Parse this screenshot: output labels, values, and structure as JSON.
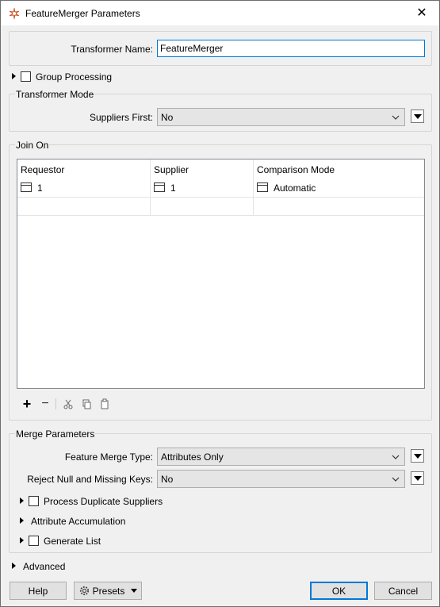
{
  "window": {
    "title": "FeatureMerger Parameters",
    "close_glyph": "✕"
  },
  "transformer_name": {
    "label": "Transformer Name:",
    "value": "FeatureMerger"
  },
  "group_processing": {
    "label": "Group Processing",
    "checked": false
  },
  "transformer_mode": {
    "group_label": "Transformer Mode",
    "suppliers_first_label": "Suppliers First:",
    "suppliers_first_value": "No"
  },
  "join_on": {
    "group_label": "Join On",
    "columns": [
      "Requestor",
      "Supplier",
      "Comparison Mode"
    ],
    "rows": [
      {
        "requestor": "1",
        "supplier": "1",
        "comparison_mode": "Automatic"
      }
    ],
    "toolbar": {
      "add_glyph": "+",
      "remove_glyph": "−"
    }
  },
  "merge_parameters": {
    "group_label": "Merge Parameters",
    "feature_merge_type_label": "Feature Merge Type:",
    "feature_merge_type_value": "Attributes Only",
    "reject_null_label": "Reject Null and Missing Keys:",
    "reject_null_value": "No",
    "process_duplicate_label": "Process Duplicate Suppliers",
    "attribute_accumulation_label": "Attribute Accumulation",
    "generate_list_label": "Generate List"
  },
  "advanced": {
    "label": "Advanced"
  },
  "buttons": {
    "help": "Help",
    "presets": "Presets",
    "ok": "OK",
    "cancel": "Cancel"
  }
}
